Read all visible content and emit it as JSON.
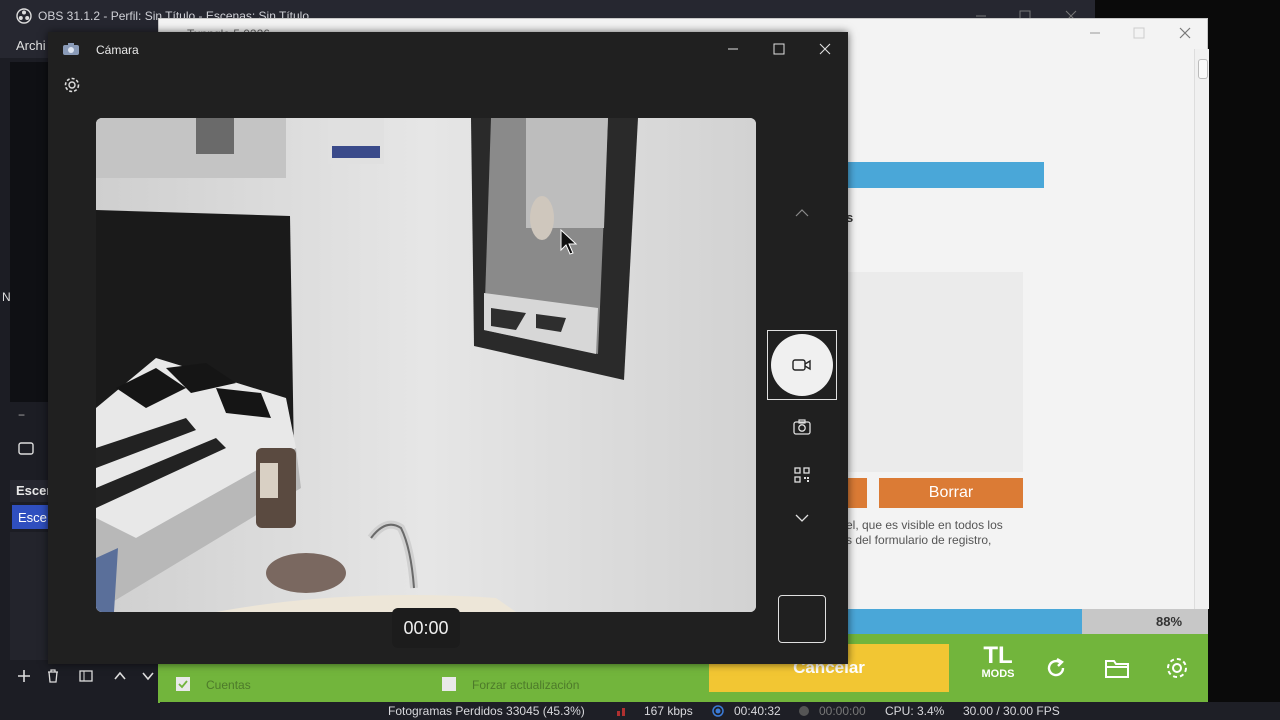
{
  "obs": {
    "title": "OBS 31.1.2 - Perfil: Sin Título - Escenas: Sin Título",
    "menu_first": "Archi",
    "scenes_header": "Escer",
    "scene_item": "Esce",
    "left_letter": "N",
    "status": {
      "dropped_frames": "Fotogramas Perdidos 33045 (45.3%)",
      "bitrate": "167 kbps",
      "rec_time": "00:40:32",
      "stream_time": "00:00:00",
      "cpu": "CPU: 3.4%",
      "fps": "30.00 / 30.00 FPS"
    }
  },
  "tunngle": {
    "title": "Tunngle 5.0226",
    "partial_text_s": "s",
    "delete_button": "Borrar",
    "description_line1": "el, que es visible en todos los",
    "description_line2": "s del formulario de registro,",
    "progress_percent": 88,
    "progress_label": "88%",
    "cancel_button": "Cancelar",
    "checkbox_accounts": "Cuentas",
    "checkbox_force_update": "Forzar actualización",
    "logo_text_top": "TL",
    "logo_text_bottom": "MODS",
    "colors": {
      "blue_bar": "#4aa7d8",
      "orange_button": "#db7b35",
      "green_footer": "#72b53c",
      "yellow_button": "#f2c633"
    }
  },
  "camera": {
    "title": "Cámara",
    "timer": "00:00",
    "icons": [
      "camera-app-icon",
      "settings-icon",
      "minimize-icon",
      "maximize-icon",
      "close-icon",
      "chevron-up-icon",
      "video-record-icon",
      "photo-camera-icon",
      "qr-code-icon",
      "chevron-down-icon",
      "thumbnail-preview"
    ]
  }
}
